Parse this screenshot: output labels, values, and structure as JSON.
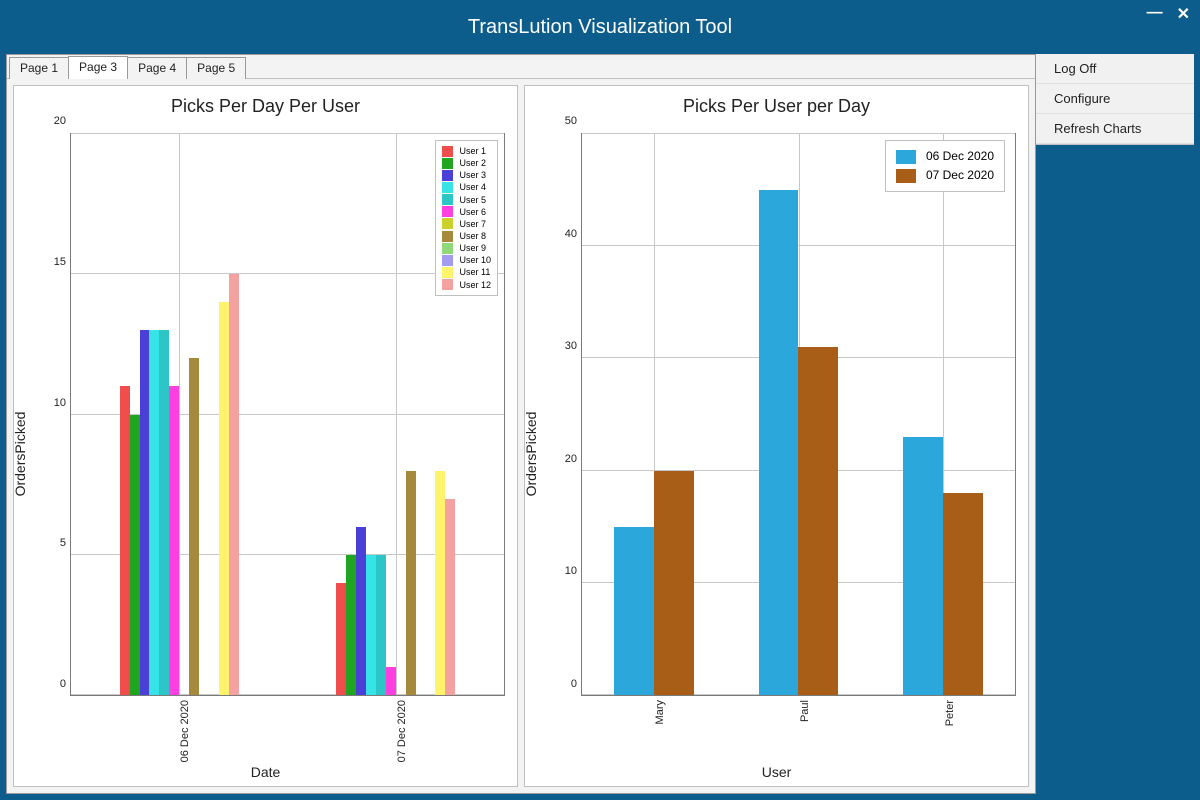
{
  "window": {
    "title": "TransLution Visualization Tool"
  },
  "tabs": [
    "Page 1",
    "Page 3",
    "Page 4",
    "Page 5"
  ],
  "active_tab_index": 1,
  "sidebar_menu": [
    "Log Off",
    "Configure",
    "Refresh Charts"
  ],
  "chart_data": [
    {
      "type": "bar",
      "title": "Picks Per Day Per User",
      "xlabel": "Date",
      "ylabel": "OrdersPicked",
      "ylim": [
        0,
        20
      ],
      "yticks": [
        0,
        5,
        10,
        15,
        20
      ],
      "categories": [
        "06 Dec 2020",
        "07 Dec 2020"
      ],
      "legend_position": "top-right-inside",
      "series": [
        {
          "name": "User 1",
          "color": "#f04d4d",
          "values": [
            11,
            4
          ]
        },
        {
          "name": "User 2",
          "color": "#1fa51f",
          "values": [
            10,
            5
          ]
        },
        {
          "name": "User 3",
          "color": "#4a3fd6",
          "values": [
            13,
            6
          ]
        },
        {
          "name": "User 4",
          "color": "#36e4e7",
          "values": [
            13,
            5
          ]
        },
        {
          "name": "User 5",
          "color": "#2cc6c9",
          "values": [
            13,
            5
          ]
        },
        {
          "name": "User 6",
          "color": "#ff3fe0",
          "values": [
            11,
            1
          ]
        },
        {
          "name": "User 7",
          "color": "#ccd02b",
          "values": [
            0,
            0
          ]
        },
        {
          "name": "User 8",
          "color": "#a58a3e",
          "values": [
            12,
            8
          ]
        },
        {
          "name": "User 9",
          "color": "#8fd97a",
          "values": [
            0,
            0
          ]
        },
        {
          "name": "User 10",
          "color": "#a49af0",
          "values": [
            0,
            0
          ]
        },
        {
          "name": "User 11",
          "color": "#fff36b",
          "values": [
            14,
            8
          ]
        },
        {
          "name": "User 12",
          "color": "#f4a1a1",
          "values": [
            15,
            7
          ]
        }
      ]
    },
    {
      "type": "bar",
      "title": "Picks Per User per Day",
      "xlabel": "User",
      "ylabel": "OrdersPicked",
      "ylim": [
        0,
        50
      ],
      "yticks": [
        0,
        10,
        20,
        30,
        40,
        50
      ],
      "categories": [
        "Mary",
        "Paul",
        "Peter"
      ],
      "legend_position": "top-right-inside",
      "series": [
        {
          "name": "06 Dec 2020",
          "color": "#2ca7db",
          "values": [
            15,
            45,
            23
          ]
        },
        {
          "name": "07 Dec 2020",
          "color": "#a85e17",
          "values": [
            20,
            31,
            18
          ]
        }
      ]
    }
  ]
}
